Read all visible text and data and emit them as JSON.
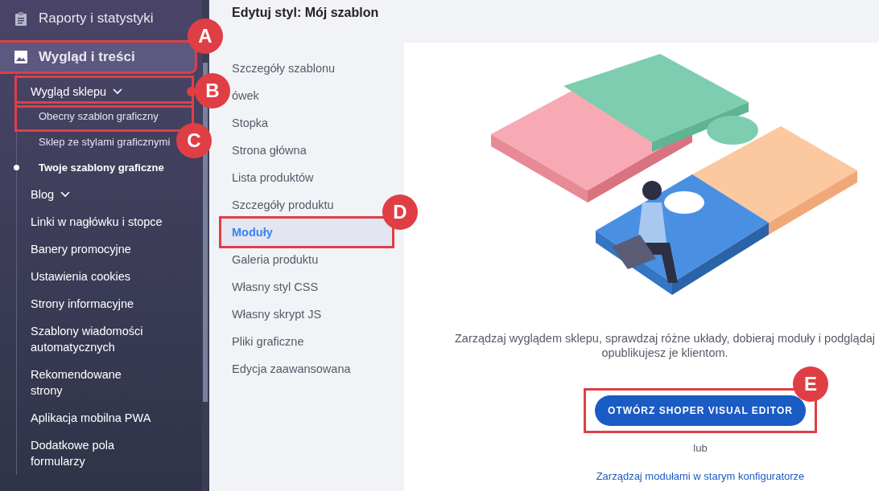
{
  "sidebar": {
    "items": [
      {
        "label": "Raporty i statystyki",
        "selected": false
      },
      {
        "label": "Wygląd i treści",
        "selected": true,
        "callout": {
          "label": "A",
          "kind": "corner"
        },
        "children": [
          {
            "label": "Wygląd sklepu",
            "expandable": true,
            "callout": {
              "label": "B",
              "kind": "leader"
            },
            "children": [
              {
                "label": "Obecny szablon graficzny",
                "selected": false,
                "callout": {
                  "label": "C",
                  "kind": "below"
                }
              },
              {
                "label": "Sklep ze stylami graficznymi",
                "selected": false
              },
              {
                "label": "Twoje szablony graficzne",
                "selected": true
              }
            ]
          },
          {
            "label": "Blog",
            "expandable": true
          },
          {
            "label": "Linki w nagłówku i stopce",
            "expandable": false
          },
          {
            "label": "Banery promocyjne",
            "expandable": false
          },
          {
            "label": "Ustawienia cookies",
            "expandable": false
          },
          {
            "label": "Strony informacyjne",
            "expandable": false
          },
          {
            "label": "Szablony wiadomości\nautomatycznych",
            "expandable": false
          },
          {
            "label": "Rekomendowane\nstrony",
            "expandable": false
          },
          {
            "label": "Aplikacja mobilna PWA",
            "expandable": false
          },
          {
            "label": "Dodatkowe pola\nformularzy",
            "expandable": false
          }
        ]
      }
    ]
  },
  "page_title": "Edytuj styl: Mój szablon",
  "style_menu": [
    {
      "label": "Szczegóły szablonu",
      "selected": false
    },
    {
      "label": "ówek",
      "selected": false
    },
    {
      "label": "Stopka",
      "selected": false
    },
    {
      "label": "Strona główna",
      "selected": false
    },
    {
      "label": "Lista produktów",
      "selected": false
    },
    {
      "label": "Szczegóły produktu",
      "selected": false
    },
    {
      "label": "Moduły",
      "selected": true,
      "callout": {
        "label": "D",
        "kind": "corner"
      }
    },
    {
      "label": "Galeria produktu",
      "selected": false
    },
    {
      "label": "Własny styl CSS",
      "selected": false
    },
    {
      "label": "Własny skrypt JS",
      "selected": false
    },
    {
      "label": "Pliki graficzne",
      "selected": false
    },
    {
      "label": "Edycja zaawansowana",
      "selected": false
    }
  ],
  "panel": {
    "description": [
      "Zarządzaj wyglądem sklepu, sprawdzaj różne układy, dobieraj moduły i podglądaj",
      "opublikujesz je klientom."
    ],
    "primary_button": {
      "label": "OTWÓRZ SHOPER VISUAL EDITOR",
      "callout": {
        "label": "E",
        "kind": "corner"
      }
    },
    "separator": "lub",
    "link": "Zarządzaj modułami w starym konfiguratorze"
  }
}
